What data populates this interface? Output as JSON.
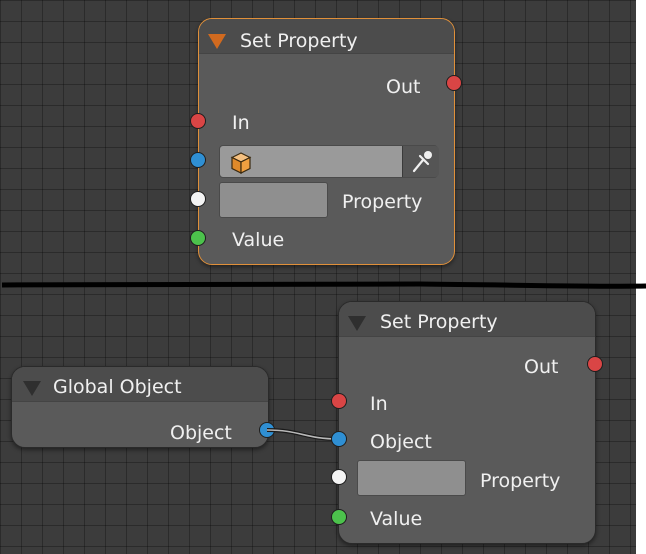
{
  "colors": {
    "grid_bg": "#3c3c3c",
    "node_bg": "#5a5a5a",
    "selected_outline": "#e0903a",
    "socket_red": "#d94545",
    "socket_blue": "#2f8fd3",
    "socket_white": "#f4f4f4",
    "socket_green": "#4cc24c",
    "divider": "#000000"
  },
  "top_node": {
    "title": "Set Property",
    "selected": true,
    "outputs": {
      "out": "Out"
    },
    "inputs": {
      "in": "In",
      "object_icon": "cube-icon",
      "eyedropper_icon": "eyedropper-icon",
      "property": "Property",
      "value": "Value"
    }
  },
  "global_object_node": {
    "title": "Global Object",
    "outputs": {
      "object": "Object"
    }
  },
  "bottom_node": {
    "title": "Set Property",
    "outputs": {
      "out": "Out"
    },
    "inputs": {
      "in": "In",
      "object": "Object",
      "property": "Property",
      "value": "Value"
    }
  }
}
